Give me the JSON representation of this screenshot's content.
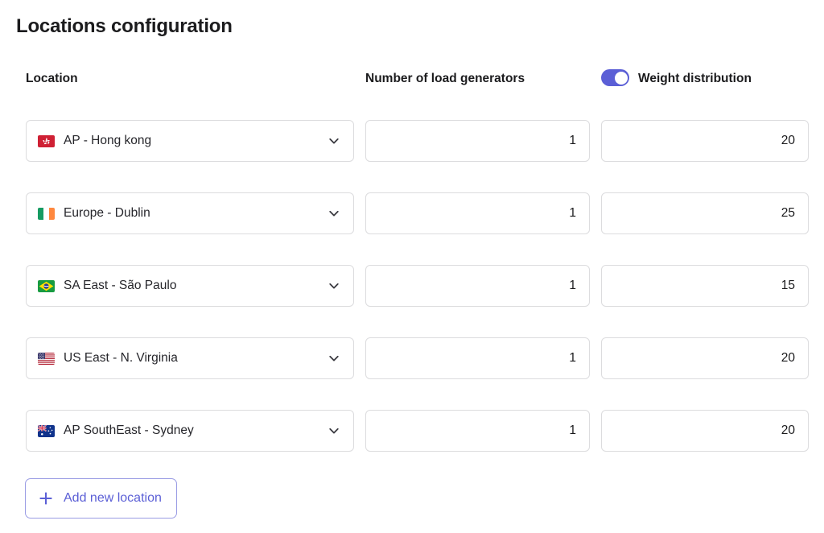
{
  "page": {
    "title": "Locations configuration"
  },
  "headers": {
    "location": "Location",
    "generators": "Number of load generators",
    "weight": "Weight distribution"
  },
  "toggle": {
    "name": "weight-distribution-toggle",
    "state": "on",
    "color": "#5b5fd6"
  },
  "colors": {
    "accent": "#5b5fd6",
    "accent_border": "#9a9ce4",
    "field_border": "#dcdcde",
    "text": "#1b1b1d"
  },
  "rows": [
    {
      "flag": "flag-hong-kong",
      "location": "AP - Hong kong",
      "generators": "1",
      "weight": "20",
      "dropdown_icon": "chevron-down-icon"
    },
    {
      "flag": "flag-ireland",
      "location": "Europe - Dublin",
      "generators": "1",
      "weight": "25",
      "dropdown_icon": "chevron-down-icon"
    },
    {
      "flag": "flag-brazil",
      "location": "SA East - São Paulo",
      "generators": "1",
      "weight": "15",
      "dropdown_icon": "chevron-down-icon"
    },
    {
      "flag": "flag-united-states",
      "location": "US East - N. Virginia",
      "generators": "1",
      "weight": "20",
      "dropdown_icon": "chevron-down-icon"
    },
    {
      "flag": "flag-australia",
      "location": "AP SouthEast - Sydney",
      "generators": "1",
      "weight": "20",
      "dropdown_icon": "chevron-down-icon"
    }
  ],
  "add_button": {
    "label": "Add new location",
    "icon": "plus-icon"
  }
}
